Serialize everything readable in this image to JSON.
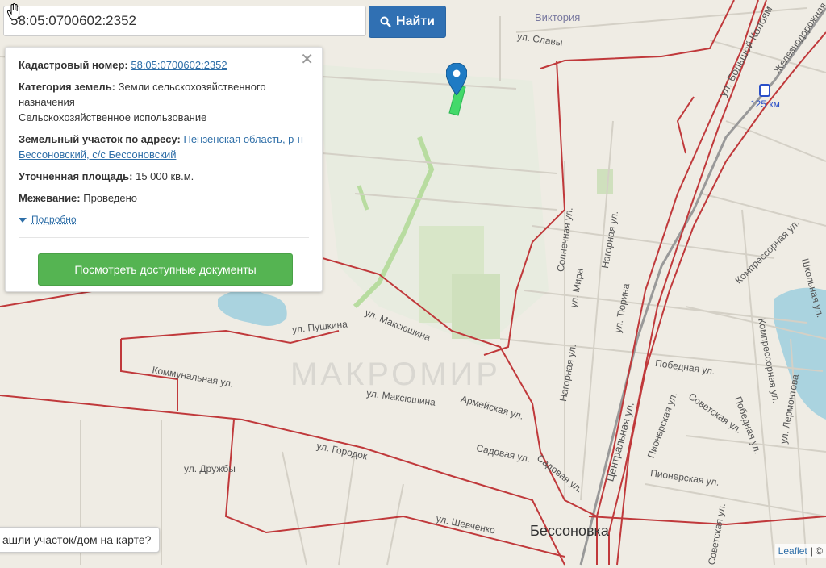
{
  "search": {
    "value": "58:05:0700602:2352",
    "button_label": "Найти"
  },
  "info_panel": {
    "cadastral_label": "Кадастровый номер:",
    "cadastral_value": "58:05:0700602:2352",
    "category_label": "Категория земель:",
    "category_value": "Земли сельскохозяйственного назначения",
    "usage_value": "Сельскохозяйственное использование",
    "address_label": "Земельный участок по адресу:",
    "address_value": "Пензенская область, р-н Бессоновский, с/с Бессоновский",
    "area_label": "Уточненная площадь:",
    "area_value": "15 000 кв.м.",
    "survey_label": "Межевание:",
    "survey_value": "Проведено",
    "more_label": "Подробно",
    "docs_button": "Посмотреть доступные документы"
  },
  "map": {
    "streets": [
      "Виктория",
      "ул. Славы",
      "ул. Большой Колоям",
      "Железнодорожная",
      "125 км",
      "ул. Пушкина",
      "ул. Максюшина",
      "Коммунальная ул.",
      "ул. Максюшина",
      "Армейская ул.",
      "ул. Городок",
      "Садовая ул.",
      "ул. Дружбы",
      "ул. Шевченко",
      "Солнечная ул.",
      "Нагорная ул.",
      "ул. Мира",
      "ул. Тюрина",
      "Нагорная ул.",
      "Центральная ул.",
      "Садовая ул.",
      "Победная ул.",
      "Пионерская ул.",
      "Советская ул.",
      "Победная ул.",
      "Пионерская ул.",
      "Компрессорная ул.",
      "Компрессорная ул.",
      "ул. Лермонтова",
      "Школьная ул.",
      "Советская ул."
    ],
    "town": "Бессоновка",
    "watermark": "МАКРОМИР",
    "road_color": "#c0393b",
    "marker_color": "#1f7bc4",
    "parcel_color": "#43d96a"
  },
  "bottom_prompt": "ашли участок/дом на карте?",
  "attribution": {
    "leaflet": "Leaflet",
    "sep": "| ©"
  }
}
